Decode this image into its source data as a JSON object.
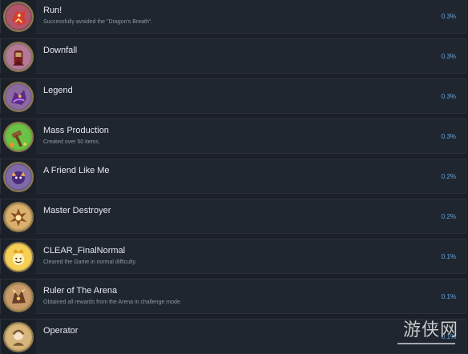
{
  "achievements": [
    {
      "name": "Run!",
      "desc": "Successfully avoided the \"Dragon's Breath\".",
      "pct": "0.3%",
      "icon": "red-dragon-icon",
      "bg": "#8a4b5b"
    },
    {
      "name": "Downfall",
      "desc": "",
      "pct": "0.3%",
      "icon": "red-knight-icon",
      "bg": "#9a6a83"
    },
    {
      "name": "Legend",
      "desc": "",
      "pct": "0.3%",
      "icon": "purple-dragon-icon",
      "bg": "#7b5f8f"
    },
    {
      "name": "Mass Production",
      "desc": "Created over 50 items.",
      "pct": "0.3%",
      "icon": "hammer-icon",
      "bg": "#62b43b"
    },
    {
      "name": "A Friend Like Me",
      "desc": "",
      "pct": "0.2%",
      "icon": "purple-creature-icon",
      "bg": "#6b5b8e"
    },
    {
      "name": "Master Destroyer",
      "desc": "",
      "pct": "0.2%",
      "icon": "golden-explosion-icon",
      "bg": "#c59a5b"
    },
    {
      "name": "CLEAR_FinalNormal",
      "desc": "Cleared the Game in normal difficulty.",
      "pct": "0.1%",
      "icon": "crowned-face-icon",
      "bg": "#f0c54a"
    },
    {
      "name": "Ruler of The Arena",
      "desc": "Obtained all rewards from the Arena in challenge mode.",
      "pct": "0.1%",
      "icon": "arena-beast-icon",
      "bg": "#b98c5a"
    },
    {
      "name": "Operator",
      "desc": "",
      "pct": "0.1%",
      "icon": "operator-icon",
      "bg": "#caa86a"
    }
  ],
  "watermark": {
    "text": "游侠网"
  }
}
